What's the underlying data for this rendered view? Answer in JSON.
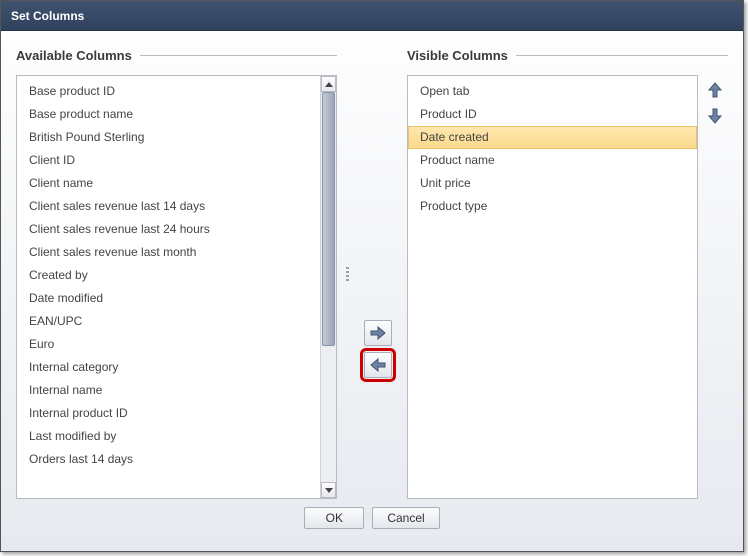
{
  "dialog": {
    "title": "Set Columns"
  },
  "available": {
    "label": "Available Columns",
    "items": [
      "Base product ID",
      "Base product name",
      "British Pound Sterling",
      "Client ID",
      "Client name",
      "Client sales revenue last 14 days",
      "Client sales revenue last 24 hours",
      "Client sales revenue last month",
      "Created by",
      "Date modified",
      "EAN/UPC",
      "Euro",
      "Internal category",
      "Internal name",
      "Internal product ID",
      "Last modified by",
      "Orders last 14 days"
    ]
  },
  "visible": {
    "label": "Visible Columns",
    "items": [
      "Open tab",
      "Product ID",
      "Date created",
      "Product name",
      "Unit price",
      "Product type"
    ],
    "selected_index": 2
  },
  "buttons": {
    "ok": "OK",
    "cancel": "Cancel"
  },
  "icons": {
    "move_right": "arrow-right-icon",
    "move_left": "arrow-left-icon",
    "move_up": "arrow-up-icon",
    "move_down": "arrow-down-icon"
  },
  "colors": {
    "titlebar_top": "#3f5270",
    "titlebar_bottom": "#30425d",
    "selected_bg_top": "#ffe7af",
    "selected_bg_bottom": "#fad98a",
    "arrow_fill": "#5a7296",
    "highlight": "#c00"
  }
}
